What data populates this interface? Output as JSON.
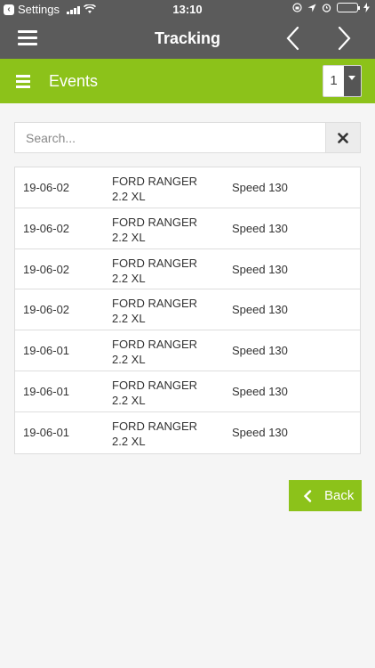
{
  "status_bar": {
    "back_app": "Settings",
    "time": "13:10"
  },
  "nav": {
    "title": "Tracking"
  },
  "events_bar": {
    "title": "Events",
    "page_selected": "1"
  },
  "search": {
    "placeholder": "Search..."
  },
  "events": [
    {
      "date": "19-06-02",
      "vehicle": "FORD RANGER 2.2 XL",
      "event": "Speed 130"
    },
    {
      "date": "19-06-02",
      "vehicle": "FORD RANGER 2.2 XL",
      "event": "Speed 130"
    },
    {
      "date": "19-06-02",
      "vehicle": "FORD RANGER 2.2 XL",
      "event": "Speed 130"
    },
    {
      "date": "19-06-02",
      "vehicle": "FORD RANGER 2.2 XL",
      "event": "Speed 130"
    },
    {
      "date": "19-06-01",
      "vehicle": "FORD RANGER 2.2 XL",
      "event": "Speed 130"
    },
    {
      "date": "19-06-01",
      "vehicle": "FORD RANGER 2.2 XL",
      "event": "Speed 130"
    },
    {
      "date": "19-06-01",
      "vehicle": "FORD RANGER 2.2 XL",
      "event": "Speed 130"
    }
  ],
  "back_button": {
    "label": "Back"
  },
  "colors": {
    "accent": "#8cc21a",
    "header": "#5b5b5b",
    "battery": "#7ddc3c"
  }
}
